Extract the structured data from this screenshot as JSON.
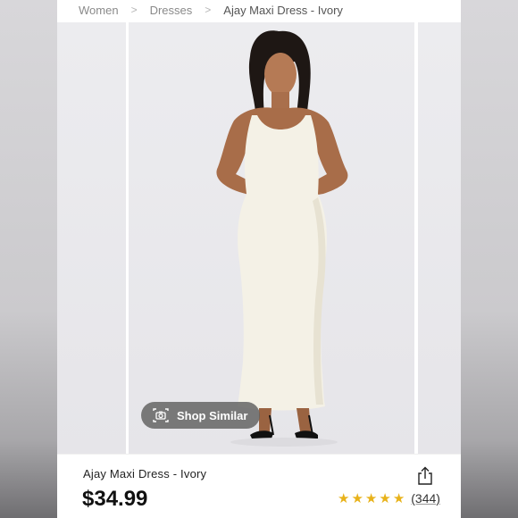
{
  "breadcrumb": {
    "items": [
      "Women",
      "Dresses",
      "Ajay Maxi Dress - Ivory"
    ],
    "separator": ">"
  },
  "gallery": {
    "shop_similar_label": "Shop Similar",
    "shop_similar_icon": "camera-icon"
  },
  "product": {
    "name": "Ajay Maxi Dress - Ivory",
    "price": "$34.99",
    "rating_stars": 5,
    "review_count": "(344)",
    "share_icon": "share-icon"
  },
  "colors": {
    "star": "#e8b21a",
    "price": "#111111",
    "dress": "#f4f1e6"
  }
}
